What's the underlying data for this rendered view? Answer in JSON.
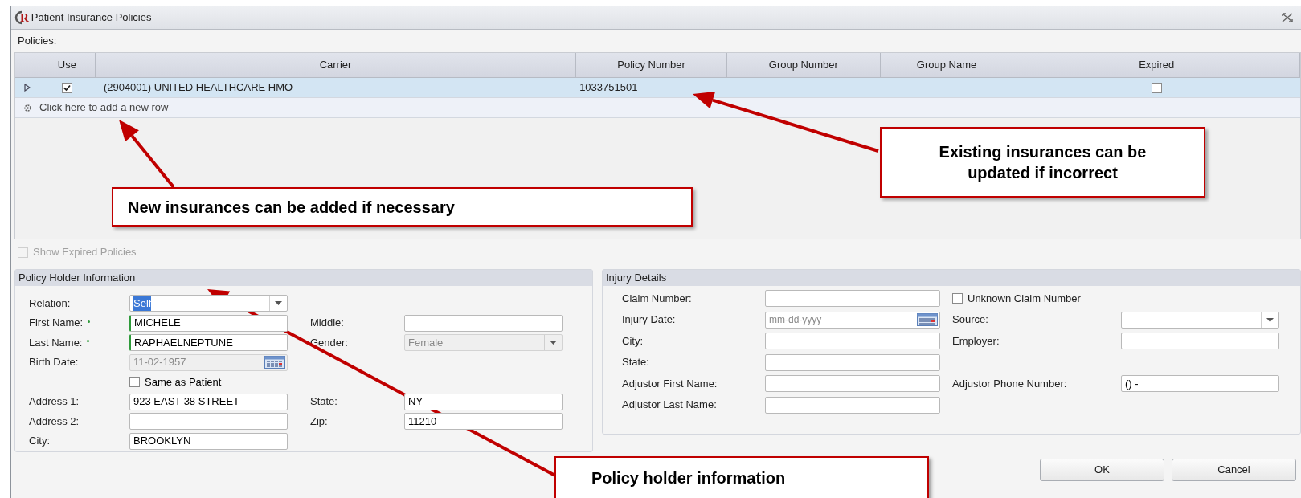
{
  "window": {
    "title": "Patient Insurance Policies",
    "logo_letter": "R"
  },
  "policies_label": "Policies:",
  "table": {
    "columns": [
      "Use",
      "Carrier",
      "Policy Number",
      "Group Number",
      "Group Name",
      "Expired"
    ],
    "rows": [
      {
        "use": true,
        "carrier": "(2904001) UNITED HEALTHCARE HMO",
        "policy_number": "1033751501",
        "expired": false,
        "selected": true
      }
    ],
    "add_row": "Click here to add a new row"
  },
  "show_expired": {
    "label": "Show Expired Policies",
    "checked": false,
    "disabled": true
  },
  "policy_holder": {
    "title": "Policy Holder Information",
    "rows": [
      {
        "left": {
          "kind": "field",
          "label": "Relation:",
          "control": {
            "kind": "select",
            "value": "Self",
            "highlighted": true
          }
        }
      },
      {
        "left": {
          "kind": "field",
          "label": "First Name:",
          "required": true,
          "control": {
            "kind": "text",
            "value": "MICHELE"
          }
        },
        "right": {
          "kind": "field",
          "label": "Middle:",
          "control": {
            "kind": "text"
          }
        }
      },
      {
        "left": {
          "kind": "field",
          "label": "Last Name:",
          "required": true,
          "control": {
            "kind": "text",
            "value": "RAPHAELNEPTUNE"
          }
        },
        "right": {
          "kind": "field",
          "label": "Gender:",
          "control": {
            "kind": "select",
            "value": "Female",
            "disabled": true
          }
        }
      },
      {
        "left": {
          "kind": "field",
          "label": "Birth Date:",
          "control": {
            "kind": "date",
            "value": "11-02-1957",
            "disabled": true
          }
        }
      },
      {
        "left": {
          "kind": "field",
          "control": {
            "kind": "checkbox",
            "label": "Same as Patient",
            "checked": false
          }
        }
      },
      {
        "left": {
          "kind": "field",
          "label": "Address 1:",
          "control": {
            "kind": "text",
            "value": "923 EAST 38 STREET"
          }
        },
        "right": {
          "kind": "field",
          "label": "State:",
          "control": {
            "kind": "text",
            "value": "NY"
          }
        }
      },
      {
        "left": {
          "kind": "field",
          "label": "Address 2:",
          "control": {
            "kind": "text"
          }
        },
        "right": {
          "kind": "field",
          "label": "Zip:",
          "control": {
            "kind": "text",
            "value": "11210"
          }
        }
      },
      {
        "left": {
          "kind": "field",
          "label": "City:",
          "control": {
            "kind": "text",
            "value": "BROOKLYN"
          }
        }
      }
    ]
  },
  "injury": {
    "title": "Injury Details",
    "rows": [
      {
        "left": {
          "kind": "field",
          "label": "Claim Number:",
          "control": {
            "kind": "text"
          }
        },
        "right": {
          "kind": "checkbox",
          "label": "Unknown Claim Number",
          "checked": false
        }
      },
      {
        "left": {
          "kind": "field",
          "label": "Injury Date:",
          "control": {
            "kind": "date",
            "placeholder": "mm-dd-yyyy"
          }
        },
        "right": {
          "kind": "field",
          "label": "Source:",
          "control": {
            "kind": "select"
          }
        }
      },
      {
        "left": {
          "kind": "field",
          "label": "City:",
          "control": {
            "kind": "text"
          }
        },
        "right": {
          "kind": "field",
          "label": "Employer:",
          "control": {
            "kind": "text"
          }
        }
      },
      {
        "left": {
          "kind": "field",
          "label": "State:",
          "control": {
            "kind": "text"
          }
        }
      },
      {
        "left": {
          "kind": "field",
          "label": "Adjustor First Name:",
          "control": {
            "kind": "text"
          }
        },
        "right": {
          "kind": "field",
          "label": "Adjustor Phone Number:",
          "control": {
            "kind": "text",
            "value": "() -"
          }
        }
      },
      {
        "left": {
          "kind": "field",
          "label": "Adjustor Last Name:",
          "control": {
            "kind": "text"
          }
        }
      }
    ]
  },
  "buttons": [
    "OK",
    "Cancel"
  ],
  "annotations": [
    "New insurances can be added if necessary",
    "Existing insurances can be updated if incorrect",
    "Policy holder information"
  ]
}
